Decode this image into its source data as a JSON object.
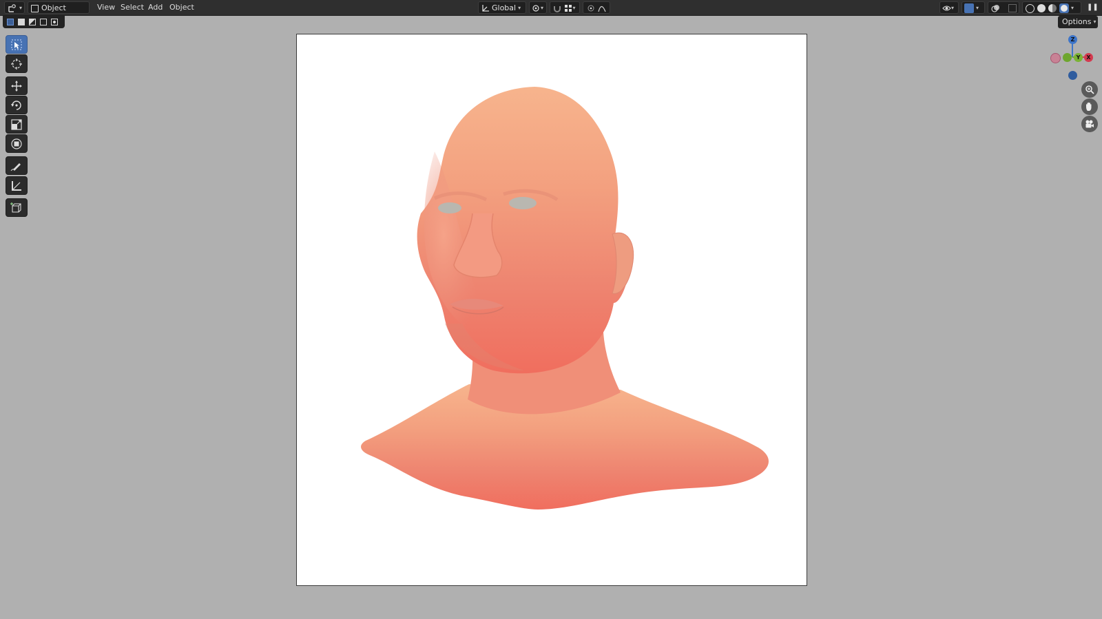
{
  "header": {
    "mode": "Object Mode",
    "menus": [
      "View",
      "Select",
      "Add",
      "Object"
    ],
    "orientation": "Global"
  },
  "subheader": {
    "options_label": "Options"
  },
  "toolbar": {
    "tools": [
      "select-box",
      "cursor",
      "move",
      "rotate",
      "scale",
      "transform",
      "annotate",
      "measure",
      "add-cube"
    ],
    "active": "select-box"
  },
  "gizmo": {
    "axes": [
      "Z",
      "Y",
      "X"
    ],
    "colors": {
      "x": "#d33a4f",
      "y": "#6ea62e",
      "z": "#3d75c9"
    }
  },
  "viewport": {
    "background": "#b0b0b0",
    "render_background": "#ffffff",
    "subject": "sculpted human head bust",
    "skin_color": "#f18b72"
  }
}
